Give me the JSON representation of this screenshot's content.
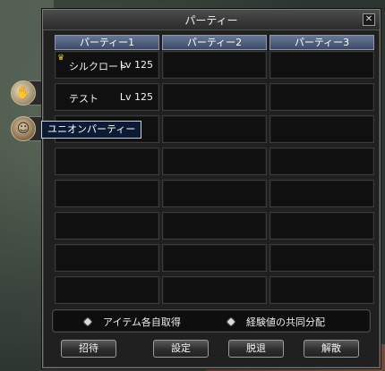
{
  "window": {
    "title": "パーティー",
    "close_glyph": "✕"
  },
  "columns": [
    {
      "header": "パーティー1",
      "slots": [
        {
          "name": "シルクロード",
          "level": "Lv 125",
          "leader": true
        },
        {
          "name": "テスト",
          "level": "Lv 125",
          "leader": false
        },
        {
          "name": "",
          "level": "",
          "leader": false
        },
        {
          "name": "",
          "level": "",
          "leader": false
        },
        {
          "name": "",
          "level": "",
          "leader": false
        },
        {
          "name": "",
          "level": "",
          "leader": false
        },
        {
          "name": "",
          "level": "",
          "leader": false
        },
        {
          "name": "",
          "level": "",
          "leader": false
        }
      ]
    },
    {
      "header": "パーティー2",
      "slots": [
        {},
        {},
        {},
        {},
        {},
        {},
        {},
        {}
      ]
    },
    {
      "header": "パーティー3",
      "slots": [
        {},
        {},
        {},
        {},
        {},
        {},
        {},
        {}
      ]
    }
  ],
  "options": {
    "item_option": "アイテム各自取得",
    "exp_option": "経験値の共同分配"
  },
  "buttons": {
    "invite": "招待",
    "settings": "設定",
    "leave": "脱退",
    "disband": "解散"
  },
  "tooltip": {
    "text": "ユニオンパーティー"
  },
  "icons": {
    "crown": "crown-icon",
    "handshake": "handshake-icon",
    "union": "union-party-icon"
  },
  "colors": {
    "header_bg": "#3c4a66",
    "crown": "#e8c43a"
  }
}
